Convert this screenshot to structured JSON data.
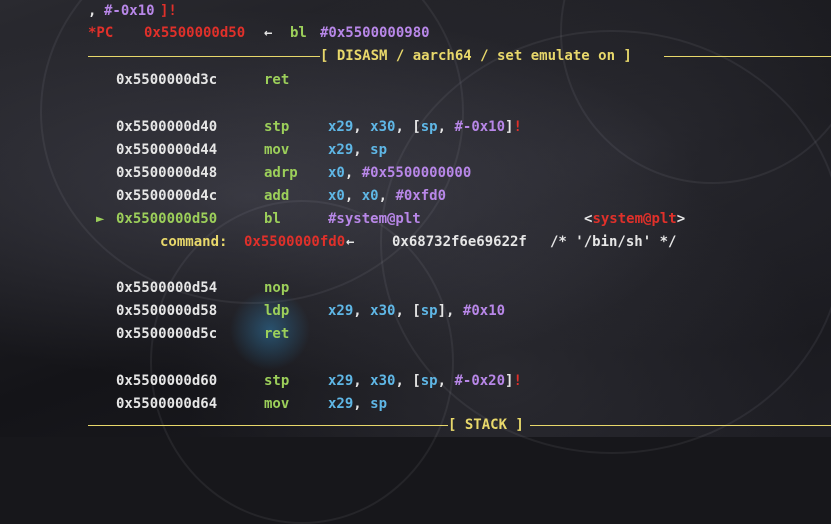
{
  "top_partial": {
    "prefix": ", ",
    "imm": "#-0x10",
    "bang": "]!"
  },
  "pc_line": {
    "marker": "*PC",
    "address": "0x5500000d50",
    "arrow": "←",
    "mnemonic": "bl",
    "target": "#0x5500000980"
  },
  "disasm_header": "[ DISASM / aarch64 / set emulate on ]",
  "instructions": [
    {
      "addr": "0x5500000d3c",
      "mnem": "ret",
      "ops": ""
    },
    {
      "addr": "0x5500000d40",
      "mnem": "stp",
      "ops": "x29, x30, [sp, #-0x10]!"
    },
    {
      "addr": "0x5500000d44",
      "mnem": "mov",
      "ops": "x29, sp"
    },
    {
      "addr": "0x5500000d48",
      "mnem": "adrp",
      "ops": "x0, #0x5500000000"
    },
    {
      "addr": "0x5500000d4c",
      "mnem": "add",
      "ops": "x0, x0, #0xfd0"
    },
    {
      "addr": "0x5500000d50",
      "mnem": "bl",
      "ops": "#system@plt",
      "comment": "<system@plt>",
      "current": true,
      "pointer": "►"
    },
    {
      "addr": "0x5500000d54",
      "mnem": "nop",
      "ops": ""
    },
    {
      "addr": "0x5500000d58",
      "mnem": "ldp",
      "ops": "x29, x30, [sp], #0x10"
    },
    {
      "addr": "0x5500000d5c",
      "mnem": "ret",
      "ops": ""
    },
    {
      "addr": "0x5500000d60",
      "mnem": "stp",
      "ops": "x29, x30, [sp, #-0x20]!"
    },
    {
      "addr": "0x5500000d64",
      "mnem": "mov",
      "ops": "x29, sp"
    }
  ],
  "command_line": {
    "label": "command:",
    "address": "0x5500000fd0",
    "arrow": "←",
    "value": "0x68732f6e69622f",
    "comment": "/* '/bin/sh' */"
  },
  "stack_header": "[ STACK ]",
  "colors": {
    "address": "#e6e6e6",
    "mnemonic": "#9ccf5a",
    "register": "#5fb7e6",
    "immediate": "#b887e8",
    "pointer_red": "#e0302a",
    "header": "#e8d86b"
  }
}
